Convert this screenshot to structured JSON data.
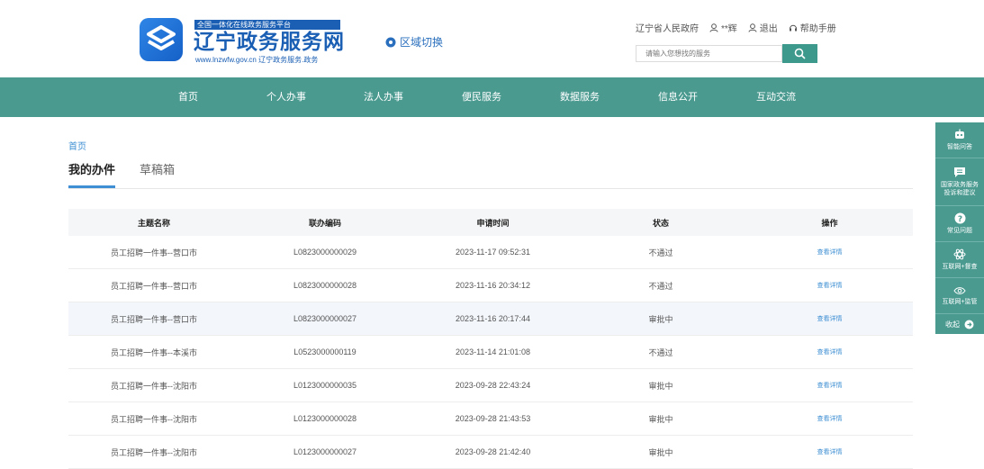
{
  "header": {
    "logo_tag": "全国一体化在线政务服务平台",
    "logo_title": "辽宁政务服务网",
    "logo_url": "www.lnzwfw.gov.cn   辽宁政务服务.政务",
    "region_label": "区域切换",
    "links": {
      "gov": "辽宁省人民政府",
      "user": "**辉",
      "logout": "退出",
      "help": "帮助手册"
    },
    "search_placeholder": "请输入您想找的服务"
  },
  "nav": [
    "首页",
    "个人办事",
    "法人办事",
    "便民服务",
    "数据服务",
    "信息公开",
    "互动交流"
  ],
  "breadcrumb": "首页",
  "tabs": {
    "active": "我的办件",
    "draft": "草稿箱"
  },
  "table": {
    "headers": [
      "主题名称",
      "联办编码",
      "申请时间",
      "状态",
      "操作"
    ],
    "rows": [
      [
        "员工招聘一件事--营口市",
        "L0823000000029",
        "2023-11-17 09:52:31",
        "不通过",
        "查看详情"
      ],
      [
        "员工招聘一件事--营口市",
        "L0823000000028",
        "2023-11-16 20:34:12",
        "不通过",
        "查看详情"
      ],
      [
        "员工招聘一件事--营口市",
        "L0823000000027",
        "2023-11-16 20:17:44",
        "审批中",
        "查看详情"
      ],
      [
        "员工招聘一件事--本溪市",
        "L0523000000119",
        "2023-11-14 21:01:08",
        "不通过",
        "查看详情"
      ],
      [
        "员工招聘一件事--沈阳市",
        "L0123000000035",
        "2023-09-28 22:43:24",
        "审批中",
        "查看详情"
      ],
      [
        "员工招聘一件事--沈阳市",
        "L0123000000028",
        "2023-09-28 21:43:53",
        "审批中",
        "查看详情"
      ],
      [
        "员工招聘一件事--沈阳市",
        "L0123000000027",
        "2023-09-28 21:42:40",
        "审批中",
        "查看详情"
      ]
    ]
  },
  "sidebar": {
    "items": [
      "智能问答",
      "国家政务服务投诉和建议",
      "常见问题",
      "互联网+督查",
      "互联网+监管"
    ],
    "collapse": "收起"
  },
  "colors": {
    "teal": "#4a9a90",
    "brand_blue": "#1a5fb4",
    "link": "#3e8fd3"
  }
}
